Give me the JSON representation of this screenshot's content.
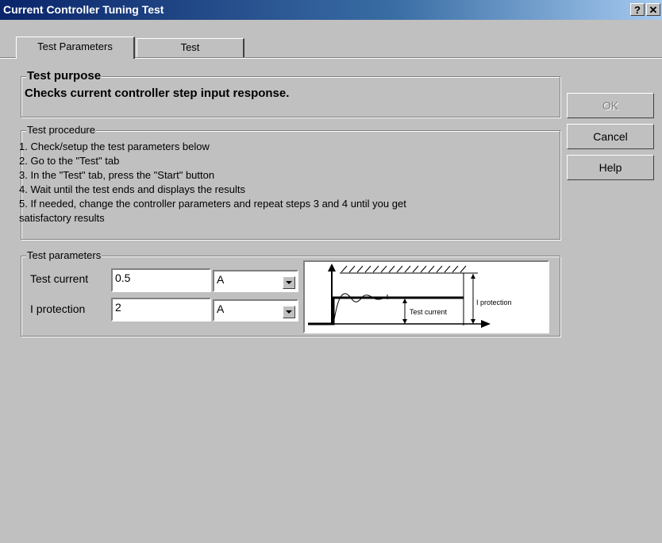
{
  "window": {
    "title": "Current Controller Tuning Test",
    "help_glyph": "?",
    "close_glyph": "✕"
  },
  "tabs": [
    {
      "label": "Test Parameters",
      "active": true
    },
    {
      "label": "Test",
      "active": false
    }
  ],
  "purpose": {
    "legend": "Test purpose",
    "text": "Checks current controller step input response."
  },
  "procedure": {
    "legend": "Test procedure",
    "lines": [
      "1. Check/setup the test parameters below",
      "2. Go to the \"Test\" tab",
      "3. In the \"Test\" tab, press the \"Start\" button",
      "4. Wait until the test ends and displays the results",
      "5. If needed, change the controller parameters and repeat steps 3 and 4 until you get",
      "satisfactory results"
    ]
  },
  "parameters": {
    "legend": "Test parameters",
    "test_current": {
      "label": "Test current",
      "value": "0.5",
      "unit": "A"
    },
    "i_protection": {
      "label": "I protection",
      "value": "2",
      "unit": "A"
    }
  },
  "diagram": {
    "test_current_label": "Test current",
    "i_protection_label": "I protection"
  },
  "buttons": {
    "ok": "OK",
    "cancel": "Cancel",
    "help": "Help"
  }
}
